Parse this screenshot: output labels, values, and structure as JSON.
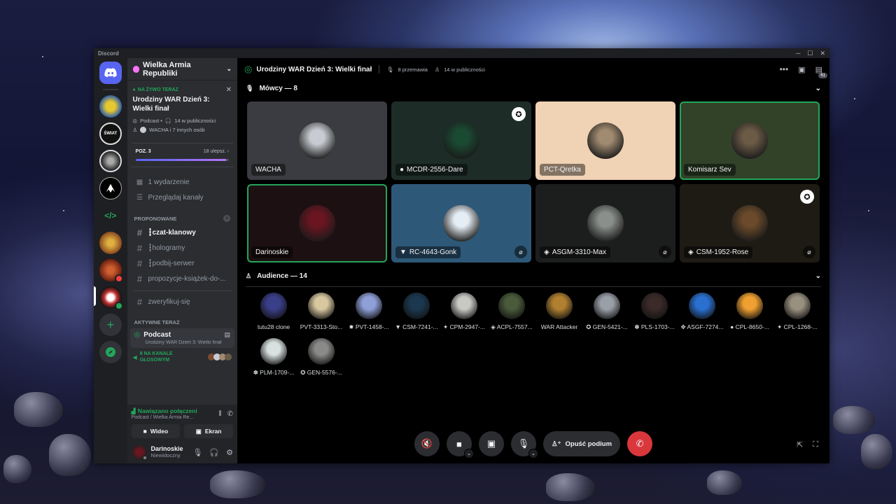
{
  "app": {
    "title": "Discord"
  },
  "server": {
    "name": "Wielka Armia Republiki"
  },
  "live_card": {
    "tag": "NA ŻYWO TERAZ",
    "title": "Urodziny WAR Dzień 3: Wielki finał",
    "meta1": "Podcast • ",
    "meta1b": "14 w publiczności",
    "meta2": "WACHA i 7 innych osób"
  },
  "boost": {
    "level": "POZ. 3",
    "count": "18 ulepsz.",
    "progress_percent": 97
  },
  "nav": {
    "events": "1 wydarzenie",
    "browse": "Przeglądaj kanały"
  },
  "suggested": {
    "header": "PROPONOWANE",
    "channels": [
      "┇czat-klanowy",
      "┇hologramy",
      "┇podbij-serwer",
      "propozycje-książek-do-..."
    ]
  },
  "verify_channel": "zweryfikuj-się",
  "active_now": {
    "header": "AKTYWNE TERAZ",
    "title": "Podcast",
    "subtitle": "Urodziny WAR Dzień 3: Wielki finał",
    "voice_count": "8 NA KANALE",
    "voice_count2": "GŁOSOWYM"
  },
  "voice_bar": {
    "status": "Nawiązano połączeni",
    "location": "Podcast / Wielka Armia Re...",
    "video_label": "Wideo",
    "screen_label": "Ekran"
  },
  "user": {
    "name": "Darinoskie",
    "status": "Niewidoczny"
  },
  "stage": {
    "title": "Urodziny WAR Dzień 3: Wielki finał",
    "speaking": "8 przemawia",
    "audience": "14 w publiczności",
    "inbox_badge": "61"
  },
  "speakers_header": "Mówcy — 8",
  "speakers": [
    {
      "name": "WACHA",
      "bg": "#3a3c41",
      "av": "#c8ccd2",
      "mod": false,
      "muted": false,
      "prefix": ""
    },
    {
      "name": "MCDR-2556-Dare",
      "bg": "#1e2c28",
      "av": "#1b4a33",
      "mod": true,
      "muted": false,
      "prefix": "●"
    },
    {
      "name": "PCT-Qretka",
      "bg": "#f0d2b4",
      "av": "#a08a70",
      "mod": false,
      "muted": false,
      "prefix": ""
    },
    {
      "name": "Komisarz Sev",
      "bg": "#314229",
      "av": "#6a5a46",
      "mod": false,
      "muted": false,
      "prefix": ""
    },
    {
      "name": "Darinoskie",
      "bg": "#1c1012",
      "av": "#6a1520",
      "mod": false,
      "muted": false,
      "prefix": ""
    },
    {
      "name": "RC-4643-Gonk",
      "bg": "#2e5878",
      "av": "#e6eef5",
      "mod": false,
      "muted": true,
      "prefix": "▼"
    },
    {
      "name": "ASGM-3310-Max",
      "bg": "#1c1e1d",
      "av": "#8a8f8b",
      "mod": false,
      "muted": true,
      "prefix": "◈"
    },
    {
      "name": "CSM-1952-Rose",
      "bg": "#1e1b14",
      "av": "#6a4a2a",
      "mod": true,
      "muted": true,
      "prefix": "◈"
    }
  ],
  "audience_header": "Audience — 14",
  "audience": [
    {
      "name": "tutu28 clone",
      "av": "#3a3f8a"
    },
    {
      "name": "PVT-3313-Sto...",
      "av": "#d8c8a0"
    },
    {
      "name": "✹ PVT-1458-...",
      "av": "#8fa0d8"
    },
    {
      "name": "▼ CSM-7241-...",
      "av": "#1c3850"
    },
    {
      "name": "✦ CPM-2947-...",
      "av": "#c8c8c4"
    },
    {
      "name": "◈ ACPL-7557...",
      "av": "#4a5a3a"
    },
    {
      "name": "WAR Attacker",
      "av": "#b08030"
    },
    {
      "name": "✪ GEN-5421-...",
      "av": "#9aa0a8"
    },
    {
      "name": "✽ PLS-1703-...",
      "av": "#3a2a28"
    },
    {
      "name": "✥ ASGF-7274...",
      "av": "#2a70d0"
    },
    {
      "name": "● CPL-8650-...",
      "av": "#f0a030"
    },
    {
      "name": "✦ CPL-1268-...",
      "av": "#9a9080"
    },
    {
      "name": "✽ PLM-1709-...",
      "av": "#d8e0e0"
    },
    {
      "name": "✪ GEN-5576-...",
      "av": "#8a8a88"
    }
  ],
  "controls": {
    "leave_label": "Opuść podium"
  },
  "colors": {
    "accent": "#5865f2",
    "green": "#23a55a",
    "danger": "#da373c"
  }
}
